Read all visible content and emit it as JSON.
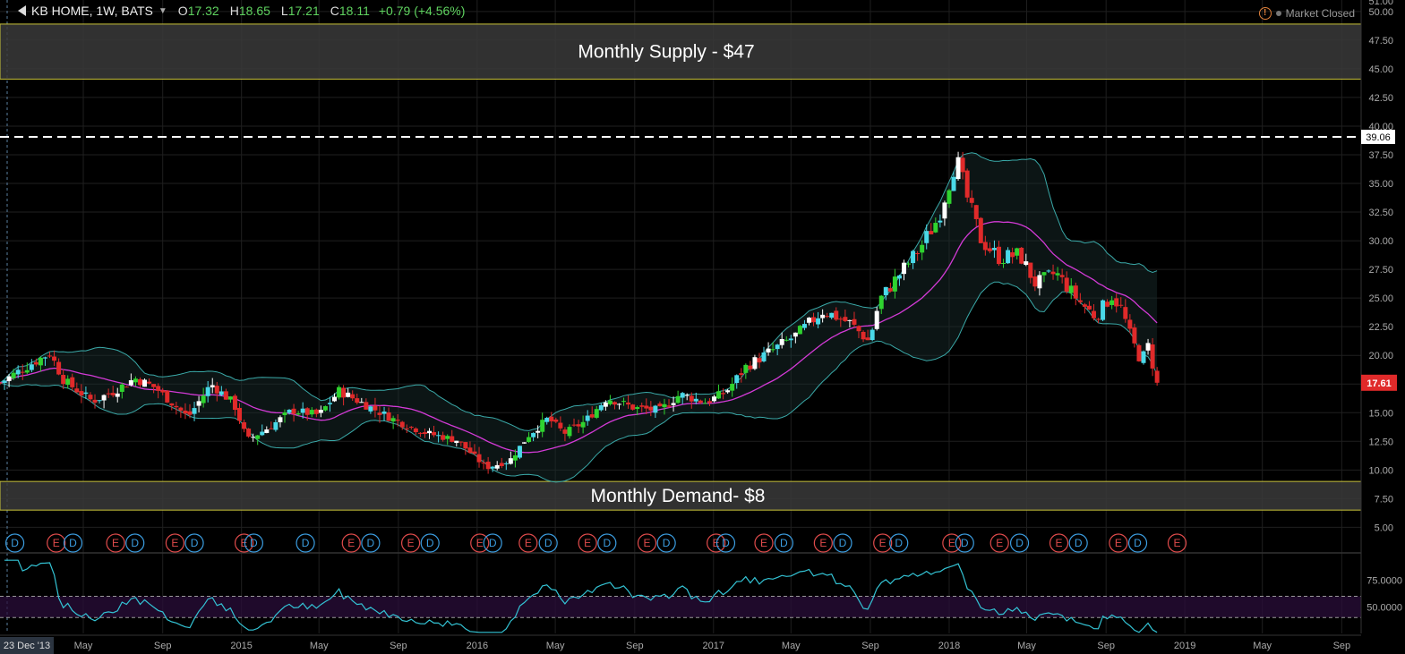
{
  "header": {
    "symbol": "KB HOME, 1W, BATS",
    "o_label": "O",
    "o_value": "17.32",
    "h_label": "H",
    "h_value": "18.65",
    "l_label": "L",
    "l_value": "17.21",
    "c_label": "C",
    "c_value": "18.11",
    "change": "+0.79 (+4.56%)",
    "market_status": "Market Closed"
  },
  "colors": {
    "background": "#000000",
    "grid": "#1f1f1f",
    "up": "#2fd32f",
    "up_alt": "#4ad9e8",
    "down": "#e02a2a",
    "basis": "#d33ad6",
    "band": "#3aa9a8",
    "zone_border": "#c9c23a",
    "zone_fill": "#3a3a3a",
    "rsi": "#33c3d4",
    "earnings": "#e04b4b",
    "dividend": "#3b9de0",
    "price_tag": "#e02a2a"
  },
  "chart_data": {
    "type": "candlestick",
    "price_axis": {
      "ylim": [
        3.0,
        51.0
      ],
      "ticks": [
        "5.00",
        "7.50",
        "10.00",
        "12.50",
        "15.00",
        "17.50",
        "20.00",
        "22.50",
        "25.00",
        "27.50",
        "30.00",
        "32.50",
        "35.00",
        "37.50",
        "40.00",
        "42.50",
        "45.00",
        "47.50",
        "50.00"
      ],
      "top_tick_partial": "51.00"
    },
    "time_axis": {
      "range_start": "2013-12-23",
      "range_end": "2019-10-01",
      "start_label": "23 Dec '13",
      "ticks": [
        {
          "label": "May",
          "date": "2014-05-01"
        },
        {
          "label": "Sep",
          "date": "2014-09-01"
        },
        {
          "label": "2015",
          "date": "2015-01-01"
        },
        {
          "label": "May",
          "date": "2015-05-01"
        },
        {
          "label": "Sep",
          "date": "2015-09-01"
        },
        {
          "label": "2016",
          "date": "2016-01-01"
        },
        {
          "label": "May",
          "date": "2016-05-01"
        },
        {
          "label": "Sep",
          "date": "2016-09-01"
        },
        {
          "label": "2017",
          "date": "2017-01-01"
        },
        {
          "label": "May",
          "date": "2017-05-01"
        },
        {
          "label": "Sep",
          "date": "2017-09-01"
        },
        {
          "label": "2018",
          "date": "2018-01-01"
        },
        {
          "label": "May",
          "date": "2018-05-01"
        },
        {
          "label": "Sep",
          "date": "2018-09-01"
        },
        {
          "label": "2019",
          "date": "2019-01-01"
        },
        {
          "label": "May",
          "date": "2019-05-01"
        },
        {
          "label": "Sep",
          "date": "2019-09-01"
        }
      ]
    },
    "zones": [
      {
        "label": "Monthly Supply - $47",
        "low": 44.1,
        "high": 48.9
      },
      {
        "label": "Monthly Demand- $8",
        "low": 6.5,
        "high": 9.0
      }
    ],
    "resistance": {
      "value": 39.06,
      "label": "39.06"
    },
    "last_price": {
      "value": 17.61,
      "label": "17.61"
    },
    "close_anchors": [
      [
        "2013-12-23",
        17.6
      ],
      [
        "2014-02-01",
        19.0
      ],
      [
        "2014-03-10",
        20.2
      ],
      [
        "2014-04-01",
        17.8
      ],
      [
        "2014-05-15",
        16.0
      ],
      [
        "2014-06-15",
        16.8
      ],
      [
        "2014-07-20",
        18.0
      ],
      [
        "2014-08-20",
        17.2
      ],
      [
        "2014-10-10",
        14.6
      ],
      [
        "2014-11-15",
        17.5
      ],
      [
        "2014-12-20",
        15.8
      ],
      [
        "2015-01-10",
        12.6
      ],
      [
        "2015-02-15",
        13.8
      ],
      [
        "2015-03-20",
        15.2
      ],
      [
        "2015-05-01",
        14.8
      ],
      [
        "2015-06-01",
        16.9
      ],
      [
        "2015-07-15",
        15.6
      ],
      [
        "2015-09-01",
        14.2
      ],
      [
        "2015-10-15",
        13.2
      ],
      [
        "2015-12-01",
        12.6
      ],
      [
        "2016-01-15",
        10.2
      ],
      [
        "2016-02-20",
        10.8
      ],
      [
        "2016-03-20",
        13.0
      ],
      [
        "2016-04-20",
        14.5
      ],
      [
        "2016-05-15",
        13.2
      ],
      [
        "2016-06-15",
        14.2
      ],
      [
        "2016-07-20",
        16.3
      ],
      [
        "2016-09-01",
        15.4
      ],
      [
        "2016-10-10",
        15.2
      ],
      [
        "2016-11-10",
        16.6
      ],
      [
        "2016-12-20",
        15.9
      ],
      [
        "2017-01-20",
        16.8
      ],
      [
        "2017-02-20",
        19.0
      ],
      [
        "2017-04-01",
        20.4
      ],
      [
        "2017-05-10",
        21.8
      ],
      [
        "2017-06-20",
        23.9
      ],
      [
        "2017-08-01",
        22.8
      ],
      [
        "2017-08-30",
        21.2
      ],
      [
        "2017-09-15",
        24.8
      ],
      [
        "2017-10-15",
        27.0
      ],
      [
        "2017-11-15",
        29.2
      ],
      [
        "2017-12-15",
        32.0
      ],
      [
        "2018-01-12",
        37.2
      ],
      [
        "2018-01-30",
        33.5
      ],
      [
        "2018-02-20",
        30.0
      ],
      [
        "2018-03-20",
        28.5
      ],
      [
        "2018-04-20",
        28.8
      ],
      [
        "2018-05-15",
        26.2
      ],
      [
        "2018-06-15",
        27.2
      ],
      [
        "2018-07-20",
        24.8
      ],
      [
        "2018-08-15",
        23.4
      ],
      [
        "2018-09-10",
        25.2
      ],
      [
        "2018-09-25",
        24.0
      ],
      [
        "2018-10-10",
        21.5
      ],
      [
        "2018-10-25",
        19.5
      ],
      [
        "2018-11-05",
        20.8
      ],
      [
        "2018-11-19",
        17.61
      ]
    ],
    "rsi": {
      "ylim": [
        25,
        95
      ],
      "ticks": [
        "50.0000",
        "75.0000"
      ],
      "upper_band": 60,
      "lower_band": 40
    },
    "event_markers": [
      {
        "type": "D",
        "date": "2014-01-15"
      },
      {
        "type": "E",
        "date": "2014-03-20"
      },
      {
        "type": "D",
        "date": "2014-04-15"
      },
      {
        "type": "E",
        "date": "2014-06-20"
      },
      {
        "type": "D",
        "date": "2014-07-20"
      },
      {
        "type": "E",
        "date": "2014-09-20"
      },
      {
        "type": "D",
        "date": "2014-10-20"
      },
      {
        "type": "E",
        "date": "2015-01-05"
      },
      {
        "type": "D",
        "date": "2015-01-20"
      },
      {
        "type": "D",
        "date": "2015-04-10"
      },
      {
        "type": "E",
        "date": "2015-06-20"
      },
      {
        "type": "D",
        "date": "2015-07-20"
      },
      {
        "type": "E",
        "date": "2015-09-20"
      },
      {
        "type": "D",
        "date": "2015-10-20"
      },
      {
        "type": "E",
        "date": "2016-01-05"
      },
      {
        "type": "D",
        "date": "2016-01-25"
      },
      {
        "type": "E",
        "date": "2016-03-20"
      },
      {
        "type": "D",
        "date": "2016-04-20"
      },
      {
        "type": "E",
        "date": "2016-06-20"
      },
      {
        "type": "D",
        "date": "2016-07-20"
      },
      {
        "type": "E",
        "date": "2016-09-20"
      },
      {
        "type": "D",
        "date": "2016-10-20"
      },
      {
        "type": "E",
        "date": "2017-01-05"
      },
      {
        "type": "D",
        "date": "2017-01-20"
      },
      {
        "type": "E",
        "date": "2017-03-20"
      },
      {
        "type": "D",
        "date": "2017-04-20"
      },
      {
        "type": "E",
        "date": "2017-06-20"
      },
      {
        "type": "D",
        "date": "2017-07-20"
      },
      {
        "type": "E",
        "date": "2017-09-20"
      },
      {
        "type": "D",
        "date": "2017-10-15"
      },
      {
        "type": "E",
        "date": "2018-01-05"
      },
      {
        "type": "D",
        "date": "2018-01-25"
      },
      {
        "type": "E",
        "date": "2018-03-20"
      },
      {
        "type": "D",
        "date": "2018-04-20"
      },
      {
        "type": "E",
        "date": "2018-06-20"
      },
      {
        "type": "D",
        "date": "2018-07-20"
      },
      {
        "type": "E",
        "date": "2018-09-20"
      },
      {
        "type": "D",
        "date": "2018-10-20"
      },
      {
        "type": "E",
        "date": "2018-12-20"
      }
    ]
  }
}
